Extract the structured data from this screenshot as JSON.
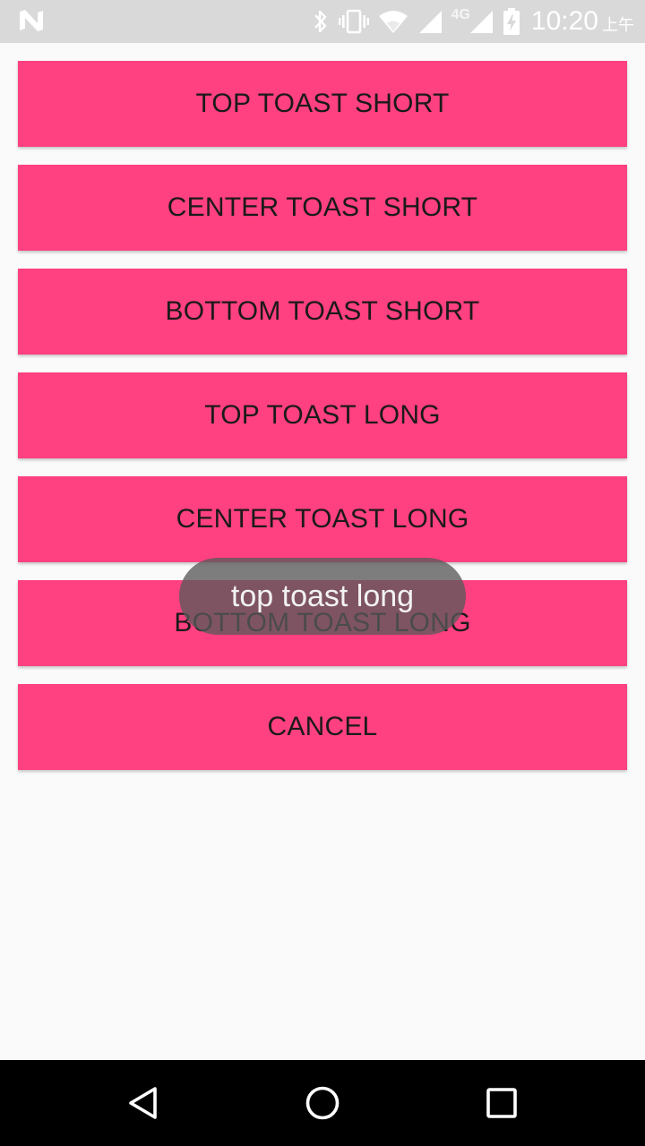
{
  "status_bar": {
    "network_type": "4G",
    "time": "10:20",
    "ampm": "上午",
    "icons": [
      "notification-n-icon",
      "bluetooth-icon",
      "vibrate-icon",
      "wifi-icon",
      "signal-icon",
      "signal-icon",
      "battery-charging-icon"
    ]
  },
  "buttons": {
    "top_short": "TOP TOAST SHORT",
    "center_short": "CENTER TOAST SHORT",
    "bottom_short": "BOTTOM TOAST SHORT",
    "top_long": "TOP TOAST LONG",
    "center_long": "CENTER TOAST LONG",
    "bottom_long": "BOTTOM TOAST LONG",
    "cancel": "CANCEL"
  },
  "toast": {
    "message": "top toast long"
  },
  "nav_bar": {
    "icons": [
      "back-icon",
      "home-icon",
      "recents-icon"
    ]
  },
  "colors": {
    "accent": "#ff4081",
    "status_bar": "#d9d9d9",
    "background": "#fafafa",
    "nav_bar": "#000000"
  }
}
